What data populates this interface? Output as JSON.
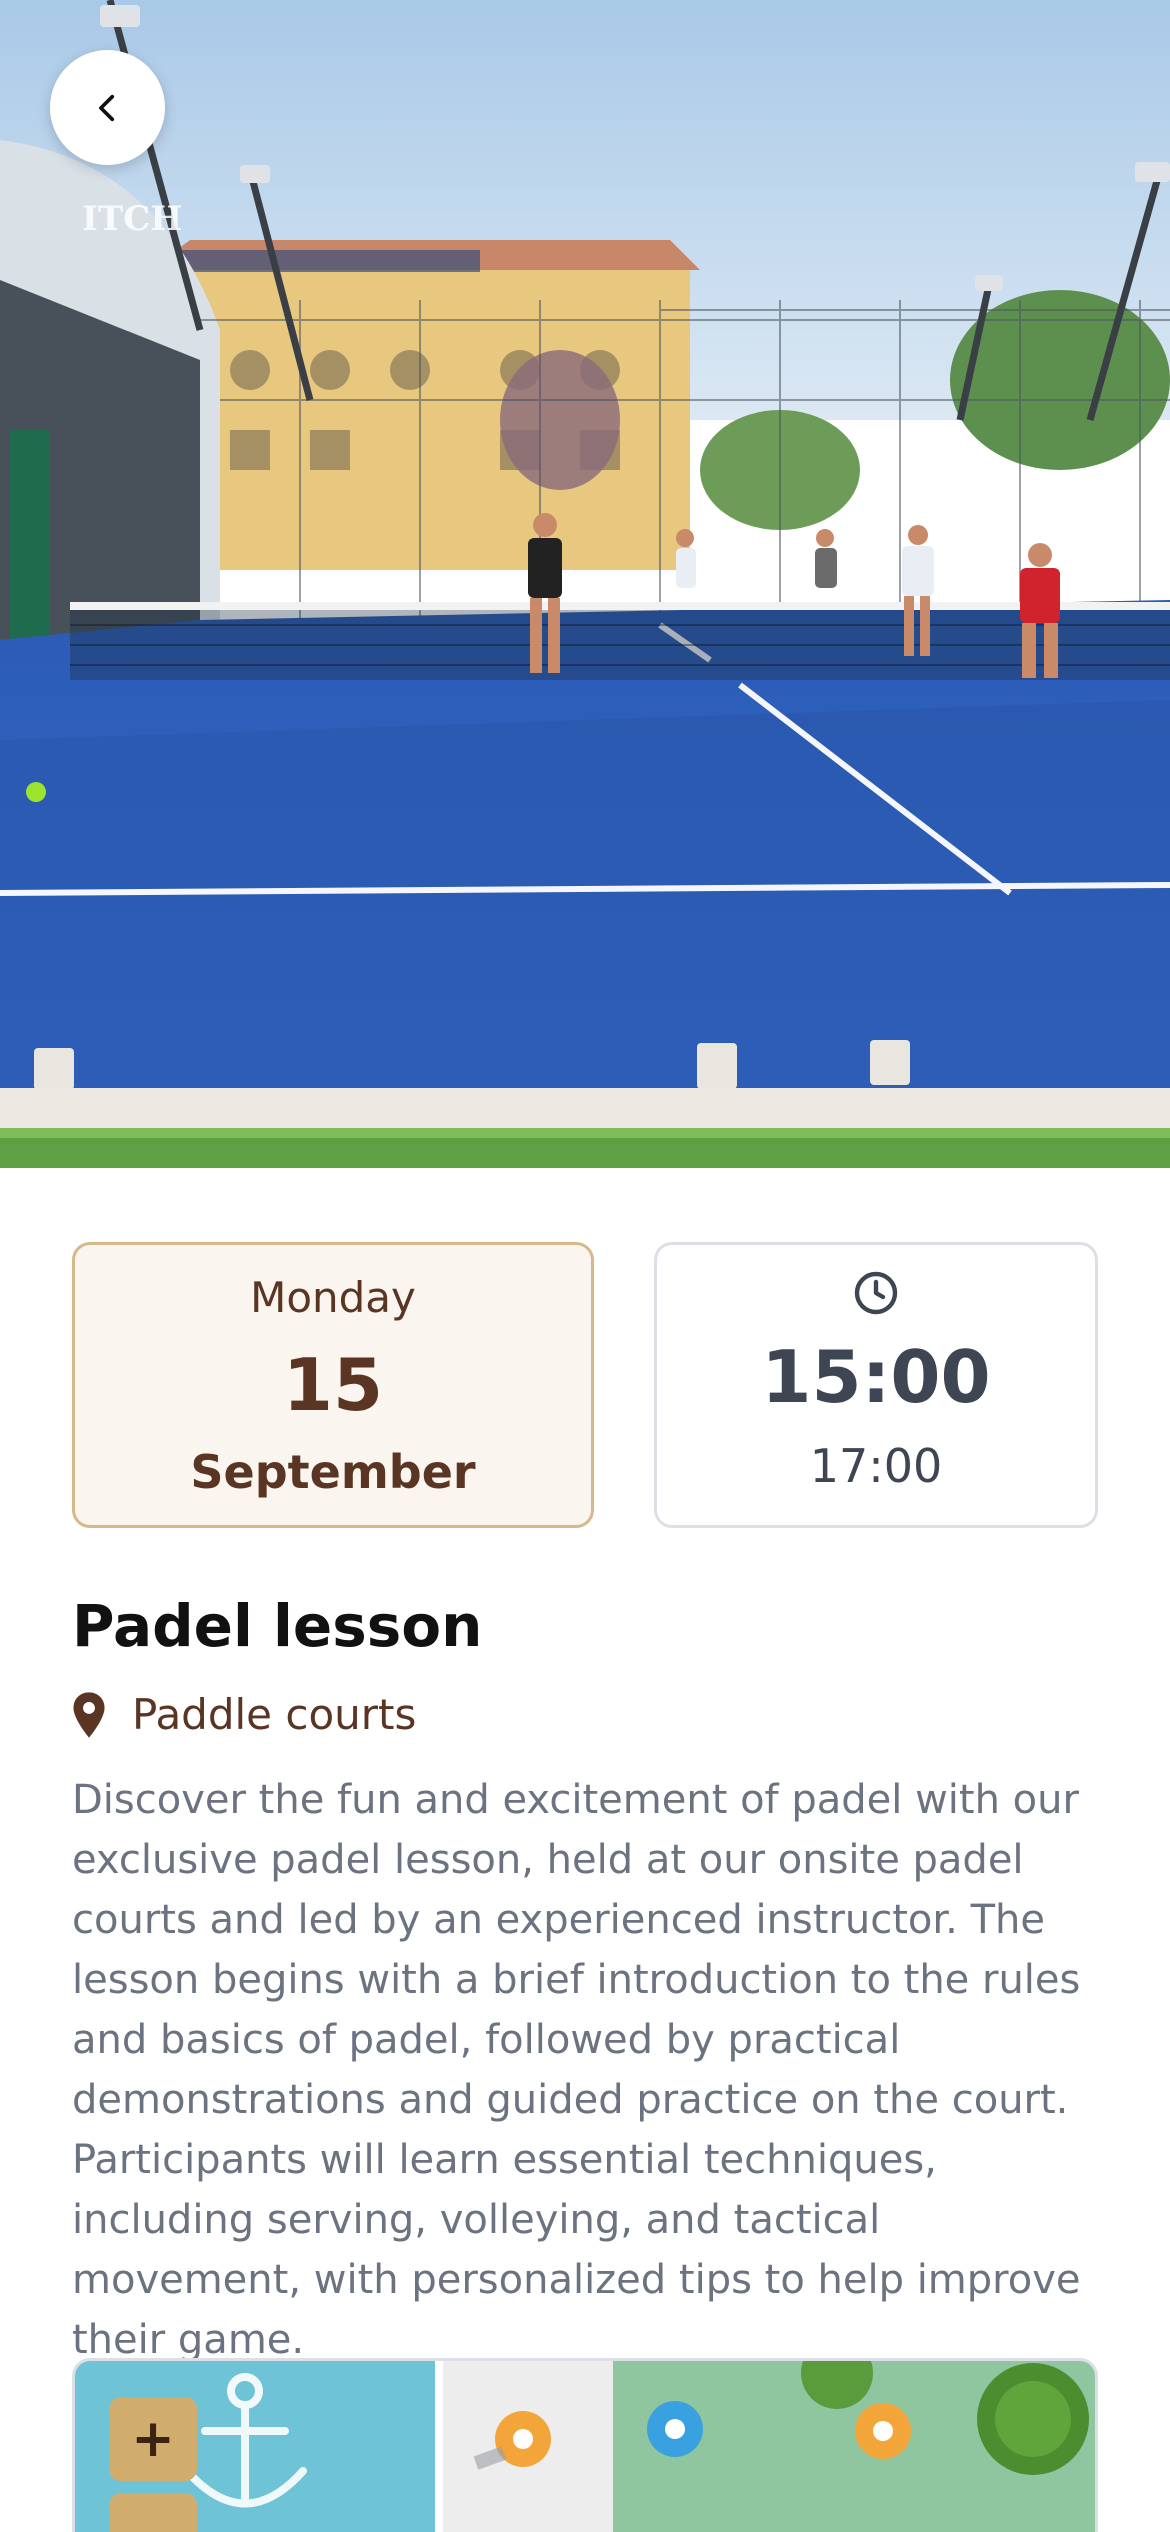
{
  "hero": {
    "image_alt": "Padel courts photo",
    "sign_text": "ITCH"
  },
  "nav": {
    "back_icon": "chevron-left-icon"
  },
  "date": {
    "weekday": "Monday",
    "day": "15",
    "month": "September"
  },
  "time": {
    "icon": "clock-icon",
    "start": "15:00",
    "end": "17:00"
  },
  "event": {
    "title": "Padel lesson",
    "location_icon": "map-pin-icon",
    "location": "Paddle courts",
    "description": "Discover the fun and excitement of padel with our exclusive padel lesson, held at our onsite padel courts and led by an experienced instructor. The lesson begins with a brief introduction to the rules and basics of padel, followed by practical demonstrations and guided practice on the court. Participants will learn essential techniques, including serving, volleying, and tactical movement, with personalized tips to help improve their game."
  },
  "map": {
    "zoom_in_label": "+"
  },
  "colors": {
    "accent_brown": "#5a3523",
    "card_border_gold": "#d6b98a",
    "card_bg_cream": "#faf6ef",
    "zoom_button": "#d1ad6d",
    "court_blue": "#2f5fb8",
    "text_gray": "#6b7280"
  }
}
